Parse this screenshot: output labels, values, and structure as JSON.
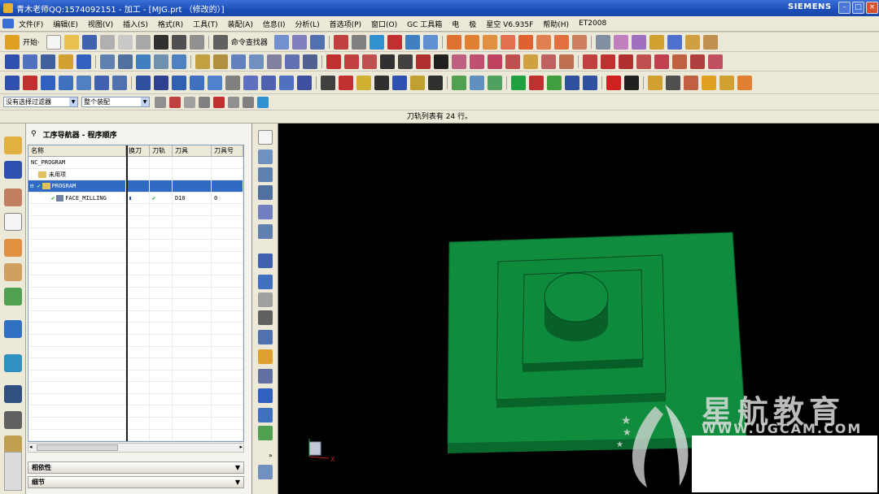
{
  "window": {
    "title": "青木老师QQ:1574092151 - 加工 - [MJG.prt （修改的）]",
    "brand": "SIEMENS",
    "minimize": "–",
    "maximize": "□",
    "close": "×"
  },
  "menubar": {
    "items": [
      "文件(F)",
      "编辑(E)",
      "视图(V)",
      "插入(S)",
      "格式(R)",
      "工具(T)",
      "装配(A)",
      "信息(I)",
      "分析(L)",
      "首选项(P)",
      "窗口(O)",
      "GC 工具箱",
      "电",
      "极",
      "星空 V6.935F",
      "帮助(H)",
      "ET2008"
    ]
  },
  "toolbar1": {
    "start_label": "开始·",
    "command_finder_label": "命令查找器"
  },
  "toolbar4": {
    "filter_combo": "没有选择过滤器",
    "assembly_combo": "整个装配"
  },
  "status": {
    "message": "刀轨列表有 24 行。"
  },
  "navigator": {
    "title": "工序导航器 - 程序顺序",
    "columns": [
      "名称",
      "换刀",
      "刀轨",
      "刀具",
      "刀具号"
    ],
    "rows": [
      {
        "name": "NC_PROGRAM",
        "tool_change": "",
        "path": "",
        "tool": "",
        "tool_no": ""
      },
      {
        "name": "未用项",
        "tool_change": "",
        "path": "",
        "tool": "",
        "tool_no": ""
      },
      {
        "name": "PROGRAM",
        "tool_change": "",
        "path": "",
        "tool": "",
        "tool_no": ""
      },
      {
        "name": "FACE_MILLING",
        "tool_change": "▮",
        "path": "✔",
        "tool": "D10",
        "tool_no": "0"
      }
    ],
    "dependencies_label": "相依性",
    "details_label": "细节"
  },
  "viewport": {
    "watermark_text": "星航教育",
    "watermark_url": "WWW.UGCAM.COM",
    "model_color": "#0e8a3c",
    "background": "#000000"
  }
}
